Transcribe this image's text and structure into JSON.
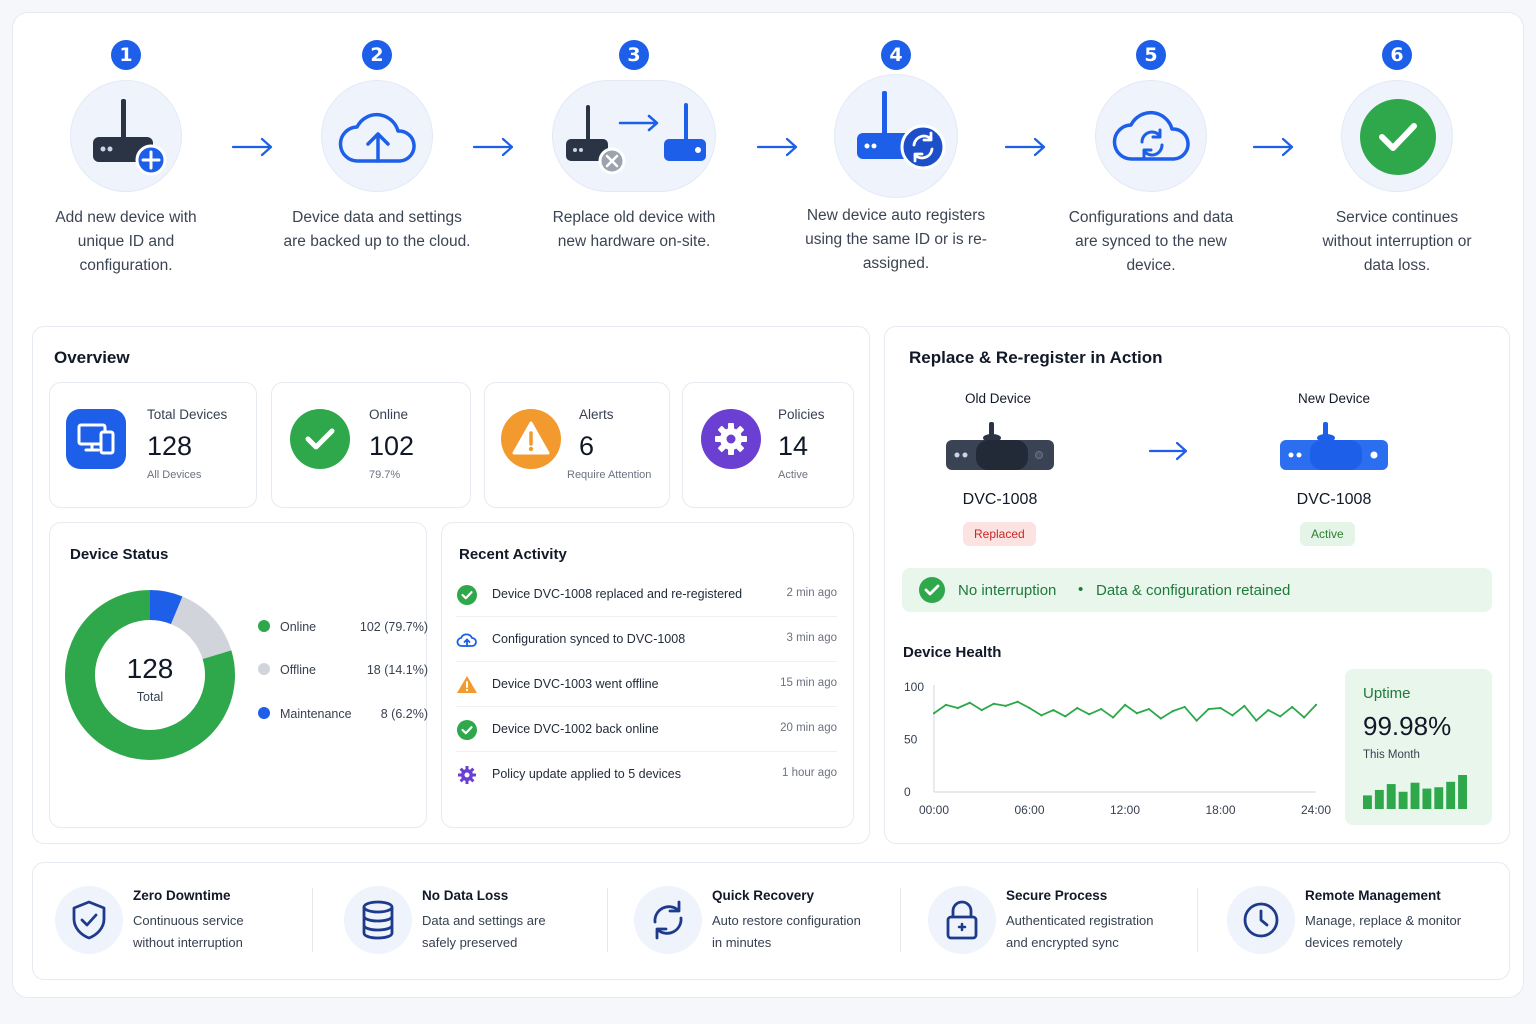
{
  "steps": [
    {
      "number": "1",
      "text": "Add new device with unique ID and configuration."
    },
    {
      "number": "2",
      "text": "Device data and settings are backed up to the cloud."
    },
    {
      "number": "3",
      "text": "Replace old device with new hardware on-site."
    },
    {
      "number": "4",
      "text": "New device auto registers using the same ID or is re-assigned."
    },
    {
      "number": "5",
      "text": "Configurations and data are synced to the new device."
    },
    {
      "number": "6",
      "text": "Service continues without interruption or data loss."
    }
  ],
  "overview": {
    "title": "Overview",
    "stats": [
      {
        "label": "Total Devices",
        "value": "128",
        "sub": "All Devices",
        "icon": "devices-icon",
        "color": "#1d5fe8"
      },
      {
        "label": "Online",
        "value": "102",
        "sub": "79.7%",
        "icon": "check-icon",
        "color": "#2ea84a"
      },
      {
        "label": "Alerts",
        "value": "6",
        "sub": "Require Attention",
        "icon": "warning-icon",
        "color": "#f29a2e"
      },
      {
        "label": "Policies",
        "value": "14",
        "sub": "Active",
        "icon": "gear-icon",
        "color": "#6a3fd1"
      }
    ]
  },
  "device_status": {
    "title": "Device Status",
    "center_value": "128",
    "center_label": "Total",
    "legend": [
      {
        "label": "Online",
        "value": "102 (79.7%)",
        "color": "#2ea84a"
      },
      {
        "label": "Offline",
        "value": "18 (14.1%)",
        "color": "#d1d5db"
      },
      {
        "label": "Maintenance",
        "value": "8 (6.2%)",
        "color": "#1d5fe8"
      }
    ]
  },
  "chart_data": [
    {
      "type": "pie",
      "title": "Device Status",
      "categories": [
        "Online",
        "Offline",
        "Maintenance"
      ],
      "values": [
        102,
        18,
        8
      ],
      "colors": [
        "#2ea84a",
        "#d1d5db",
        "#1d5fe8"
      ]
    },
    {
      "type": "line",
      "title": "Device Health",
      "xlabel": "",
      "ylabel": "",
      "x_ticks": [
        "00:00",
        "06:00",
        "12:00",
        "18:00",
        "24:00"
      ],
      "y_ticks": [
        "100",
        "50",
        "0"
      ],
      "ylim": [
        0,
        100
      ],
      "xlim": [
        0,
        24
      ],
      "x": [
        0,
        0.75,
        1.5,
        2.25,
        3,
        3.75,
        4.5,
        5.25,
        6,
        6.75,
        7.5,
        8.25,
        9,
        9.75,
        10.5,
        11.25,
        12,
        12.75,
        13.5,
        14.25,
        15,
        15.75,
        16.5,
        17.25,
        18,
        18.75,
        19.5,
        20.25,
        21,
        21.75,
        22.5,
        23.25,
        24
      ],
      "series": [
        {
          "color": "#2ea84a",
          "values": [
            75,
            83,
            80,
            85,
            78,
            84,
            82,
            86,
            80,
            73,
            78,
            72,
            80,
            74,
            79,
            71,
            83,
            75,
            79,
            70,
            77,
            81,
            68,
            79,
            80,
            73,
            82,
            68,
            78,
            72,
            81,
            71,
            83
          ]
        }
      ]
    },
    {
      "type": "bar",
      "title": "",
      "categories": [
        "1",
        "2",
        "3",
        "4",
        "5",
        "6",
        "7",
        "8",
        "9"
      ],
      "values": [
        30,
        42,
        55,
        38,
        58,
        45,
        48,
        60,
        75
      ],
      "color": "#2ea84a"
    }
  ],
  "activity": {
    "title": "Recent Activity",
    "items": [
      {
        "text": "Device DVC-1008 replaced and re-registered",
        "time": "2 min ago",
        "icon": "check-circle-icon"
      },
      {
        "text": "Configuration synced to DVC-1008",
        "time": "3 min ago",
        "icon": "cloud-sync-icon"
      },
      {
        "text": "Device DVC-1003 went offline",
        "time": "15 min ago",
        "icon": "warning-icon"
      },
      {
        "text": "Device DVC-1002 back online",
        "time": "20 min ago",
        "icon": "check-circle-icon"
      },
      {
        "text": "Policy update applied to 5 devices",
        "time": "1 hour ago",
        "icon": "gear-icon"
      }
    ]
  },
  "replace": {
    "title": "Replace & Re-register in Action",
    "old": {
      "heading": "Old Device",
      "id": "DVC-1008",
      "status": "Replaced"
    },
    "new": {
      "heading": "New Device",
      "id": "DVC-1008",
      "status": "Active"
    },
    "banner_a": "No interruption",
    "banner_sep": "•",
    "banner_b": "Data & configuration retained"
  },
  "health": {
    "title": "Device Health",
    "uptime_label": "Uptime",
    "uptime_value": "99.98%",
    "uptime_period": "This Month"
  },
  "features": [
    {
      "title": "Zero Downtime",
      "line1": "Continuous service",
      "line2": "without interruption",
      "icon": "shield-check-icon"
    },
    {
      "title": "No Data Loss",
      "line1": "Data and settings are",
      "line2": "safely preserved",
      "icon": "database-icon"
    },
    {
      "title": "Quick Recovery",
      "line1": "Auto restore configuration",
      "line2": "in minutes",
      "icon": "refresh-icon"
    },
    {
      "title": "Secure Process",
      "line1": "Authenticated registration",
      "line2": "and encrypted sync",
      "icon": "lock-icon"
    },
    {
      "title": "Remote Management",
      "line1": "Manage, replace & monitor",
      "line2": "devices remotely",
      "icon": "clock-icon"
    }
  ]
}
